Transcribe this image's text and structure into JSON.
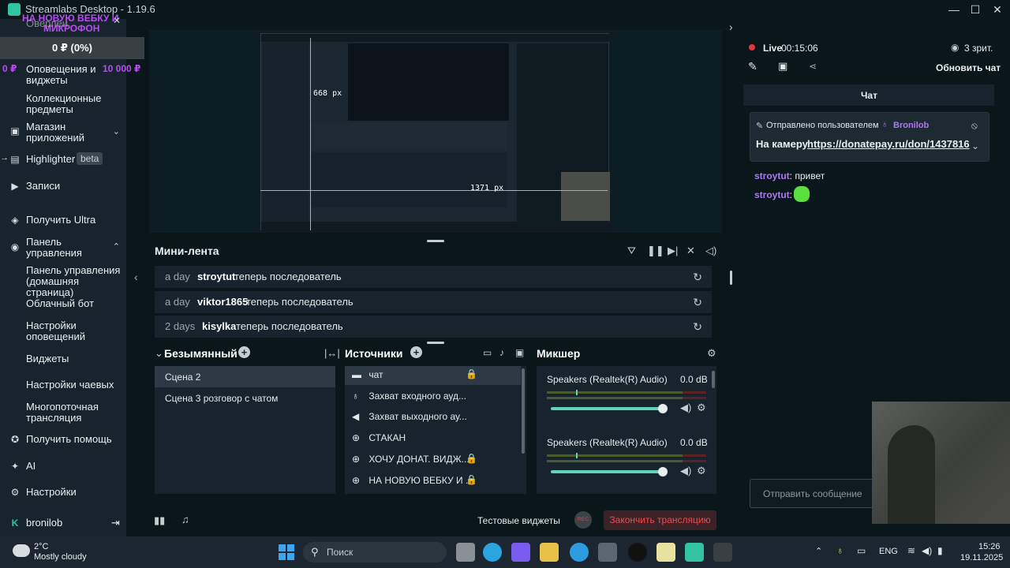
{
  "window": {
    "title": "Streamlabs Desktop - 1.19.6",
    "min": "—",
    "max": "☐",
    "close": "✕"
  },
  "goal": {
    "title_line1": "НА НОВУЮ ВЕБКУ И",
    "title_line2": "МИКРОФОН",
    "overlay_item": "Оверлеи",
    "amount": "0 ₽ (0%)",
    "min": "0 ₽",
    "max": "10 000 ₽"
  },
  "sidebar": {
    "items": [
      {
        "label": "Оповещения и виджеты",
        "icon": "bell-icon"
      },
      {
        "label": "Коллекционные предметы",
        "icon": ""
      },
      {
        "label": "Магазин приложений",
        "icon": "store-icon"
      },
      {
        "label": "Highlighter",
        "badge": "beta",
        "icon": "highlighter-icon"
      },
      {
        "label": "Записи",
        "icon": "play-icon"
      },
      {
        "label": "Получить Ultra",
        "icon": "ultra-icon"
      },
      {
        "label": "Панель управления",
        "icon": "dashboard-icon"
      },
      {
        "label": "Панель управления (домашняя страница)",
        "icon": ""
      },
      {
        "label": "Облачный бот",
        "icon": ""
      },
      {
        "label": "Настройки оповещений",
        "icon": ""
      },
      {
        "label": "Виджеты",
        "icon": ""
      },
      {
        "label": "Настройки чаевых",
        "icon": ""
      },
      {
        "label": "Многопоточная трансляция",
        "icon": ""
      },
      {
        "label": "Получить помощь",
        "icon": "help-icon"
      },
      {
        "label": "AI",
        "icon": "ai-icon"
      },
      {
        "label": "Настройки",
        "icon": "gear-icon"
      }
    ],
    "user": "bronilob"
  },
  "preview": {
    "dim_width": "668 px",
    "dim_height": "1371 px"
  },
  "minifeed": {
    "title": "Мини-лента",
    "rows": [
      {
        "time": "a day",
        "user": "stroytut",
        "action": "теперь последователь"
      },
      {
        "time": "a day",
        "user": "viktor1865",
        "action": "теперь последователь"
      },
      {
        "time": "2 days",
        "user": "kisylka",
        "action": "теперь последователь"
      }
    ]
  },
  "scenes": {
    "title": "Безымянный",
    "items": [
      "Сцена 2",
      "Сцена 3 розговор с чатом"
    ]
  },
  "sources": {
    "title": "Источники",
    "items": [
      {
        "label": "чат",
        "icon": "chat-icon"
      },
      {
        "label": "Захват входного ауд...",
        "icon": "mic-icon"
      },
      {
        "label": "Захват выходного ау...",
        "icon": "speaker-icon"
      },
      {
        "label": "СТАКАН",
        "icon": "globe-icon"
      },
      {
        "label": "ХОЧУ ДОНАТ. ВИДЖ...",
        "icon": "globe-icon"
      },
      {
        "label": "НА НОВУЮ ВЕБКУ И ...",
        "icon": "globe-icon"
      }
    ]
  },
  "mixer": {
    "title": "Микшер",
    "channels": [
      {
        "name": "Speakers (Realtek(R) Audio)",
        "db": "0.0 dB",
        "volume": 1.0
      },
      {
        "name": "Speakers (Realtek(R) Audio)",
        "db": "0.0 dB",
        "volume": 1.0
      }
    ]
  },
  "bottombar": {
    "test_widgets": "Тестовые виджеты",
    "rec": "REC",
    "end_stream": "Закончить трансляцию"
  },
  "chat": {
    "live_label": "Live",
    "live_time": "00:15:06",
    "viewers": "3 зрит.",
    "refresh": "Обновить чат",
    "title": "Чат",
    "pinned_prefix": "Отправлено пользователем",
    "pinned_user": "Bronilob",
    "pinned_text": "На камеру ",
    "pinned_link": "https://donatepay.ru/don/1437816",
    "messages": [
      {
        "user": "stroytut",
        "text": "привет"
      },
      {
        "user": "stroytut",
        "text": ""
      }
    ],
    "input_placeholder": "Отправить сообщение",
    "colors": {
      "live": "#e5363c",
      "accent": "#31c3a2",
      "username": "#b176f5"
    }
  },
  "taskbar": {
    "weather_temp": "2°C",
    "weather_desc": "Mostly cloudy",
    "search": "Поиск",
    "lang": "ENG",
    "time": "15:26",
    "date": "19.11.2025"
  }
}
